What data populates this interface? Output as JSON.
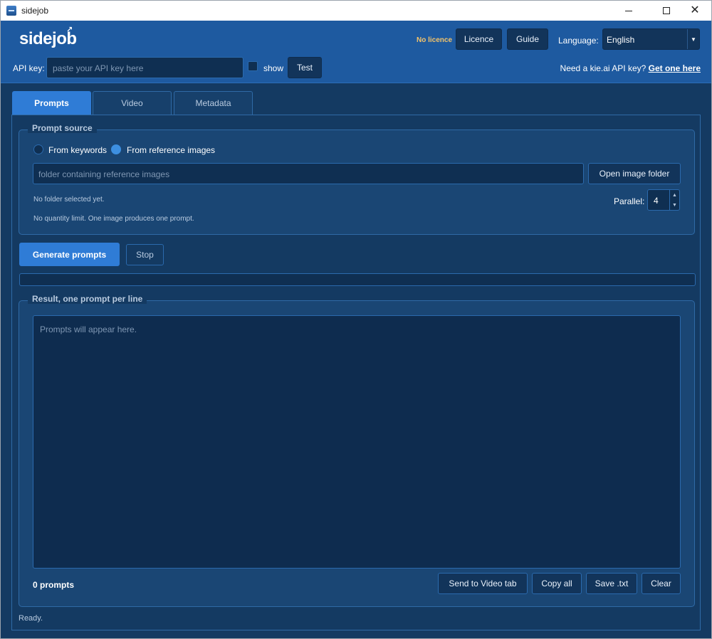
{
  "window": {
    "title": "sidejob"
  },
  "header": {
    "logo": "sidejob",
    "licence_status": "No licence",
    "licence_button": "Licence",
    "guide_button": "Guide",
    "language_label": "Language:",
    "language_value": "English",
    "api_label": "API key:",
    "api_placeholder": "paste your API key here",
    "show_label": "show",
    "test_button": "Test",
    "need_key_text": "Need a kie.ai API key?",
    "get_one_link": "Get one here"
  },
  "tabs": [
    {
      "label": "Prompts",
      "active": true
    },
    {
      "label": "Video",
      "active": false
    },
    {
      "label": "Metadata",
      "active": false
    }
  ],
  "prompt_source": {
    "title": "Prompt source",
    "radio_keywords": "From keywords",
    "radio_images": "From reference images",
    "selected": "From reference images",
    "folder_placeholder": "folder containing reference images",
    "open_folder_button": "Open image folder",
    "folder_status": "No folder selected yet.",
    "quantity_note": "No quantity limit. One image produces one prompt.",
    "parallel_label": "Parallel:",
    "parallel_value": "4"
  },
  "actions": {
    "generate_button": "Generate prompts",
    "stop_button": "Stop",
    "progress": 0
  },
  "result": {
    "title": "Result, one prompt per line",
    "placeholder": "Prompts will appear here.",
    "count": "0 prompts",
    "send_button": "Send to Video tab",
    "copy_button": "Copy all",
    "save_button": "Save .txt",
    "clear_button": "Clear"
  },
  "status": "Ready.",
  "colors": {
    "header_bg": "#1e5aa0",
    "body_bg": "#143a62",
    "accent": "#2f7cd6",
    "licence_warning": "#f2c36b"
  }
}
